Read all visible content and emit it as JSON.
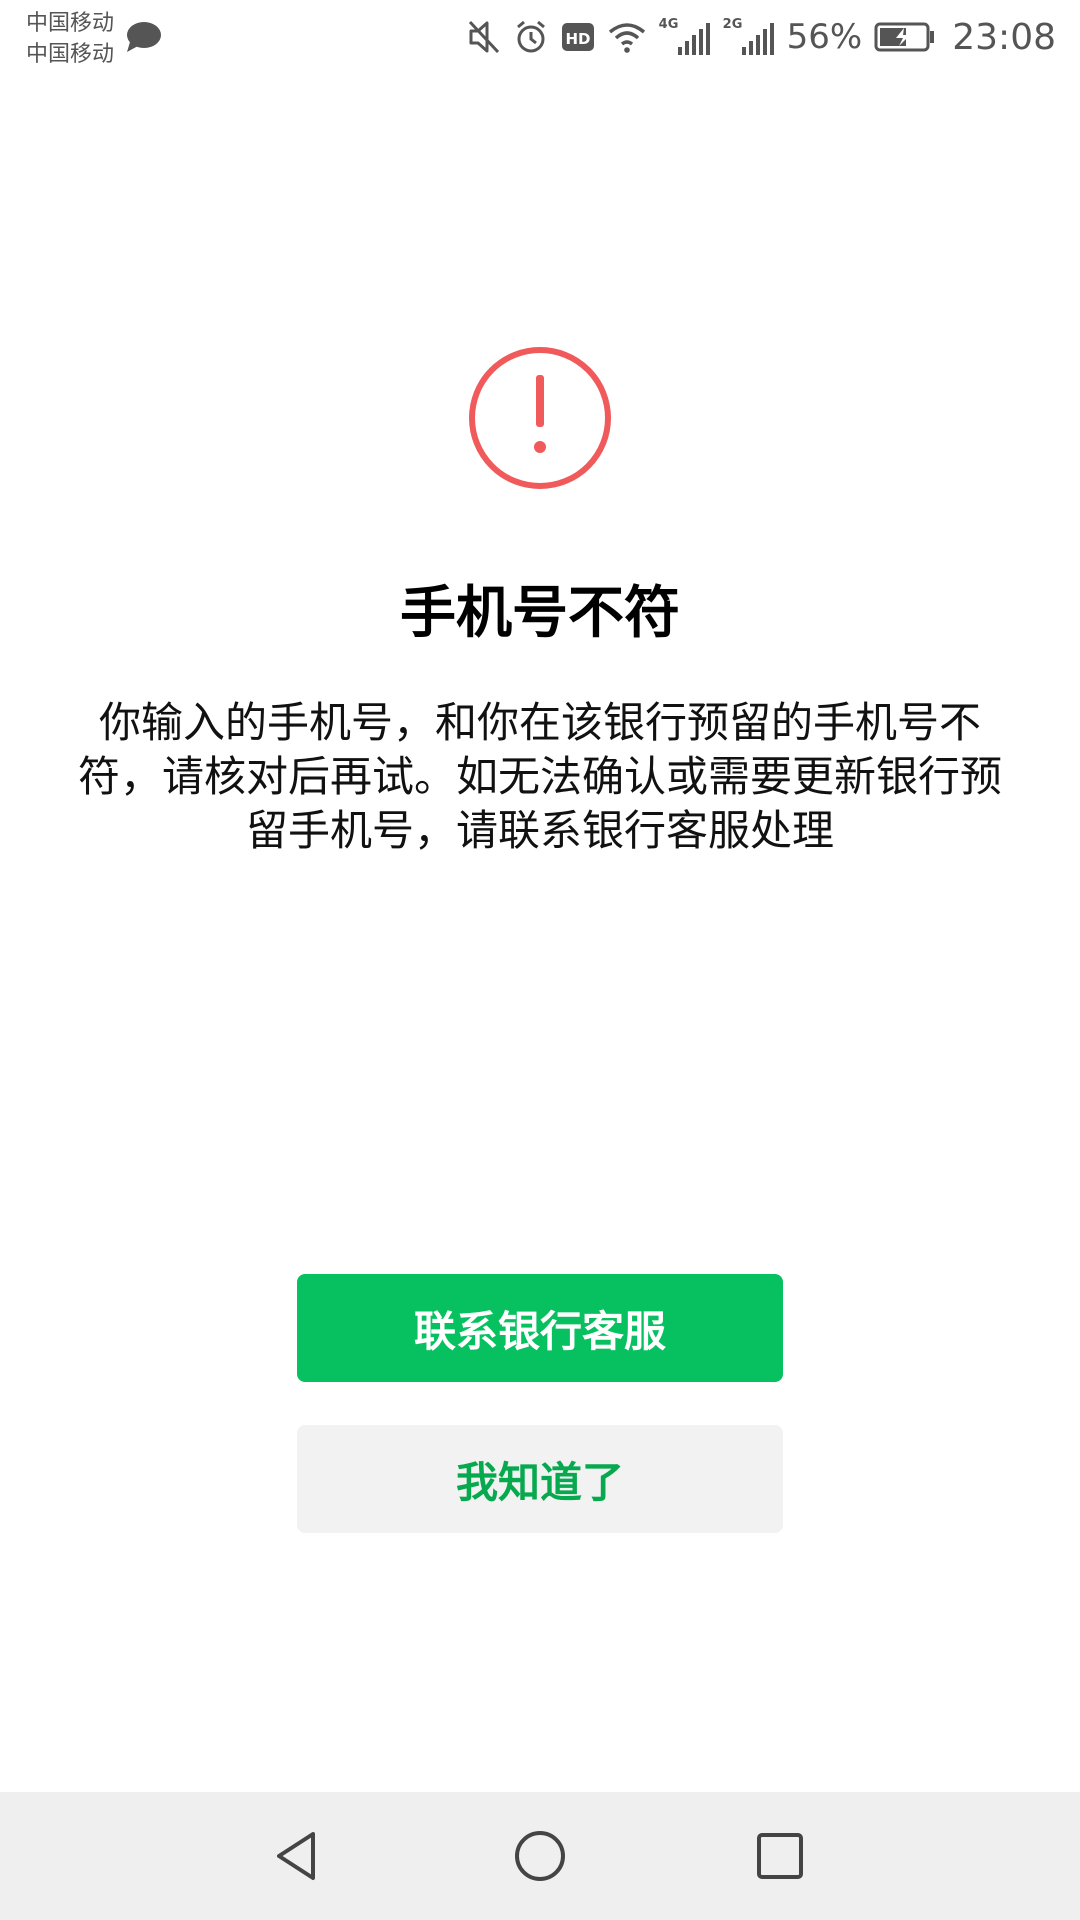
{
  "status_bar": {
    "carrier_1": "中国移动",
    "carrier_2": "中国移动",
    "network_1": "4G",
    "network_2": "2G",
    "battery_percent": "56%",
    "time": "23:08",
    "icons": [
      "chat-bubble-icon",
      "mute-icon",
      "alarm-icon",
      "hd-icon",
      "wifi-icon",
      "signal-icon",
      "battery-charging-icon"
    ]
  },
  "dialog": {
    "icon": "alert-circle-icon",
    "icon_color": "#f05a5a",
    "title": "手机号不符",
    "message": "你输入的手机号，和你在该银行预留的手机号不符，请核对后再试。如无法确认或需要更新银行预留手机号，请联系银行客服处理"
  },
  "buttons": {
    "contact_bank": "联系银行客服",
    "acknowledge": "我知道了",
    "primary_color": "#07c160"
  },
  "navigation": {
    "icons": [
      "back-icon",
      "home-icon",
      "recents-icon"
    ]
  }
}
